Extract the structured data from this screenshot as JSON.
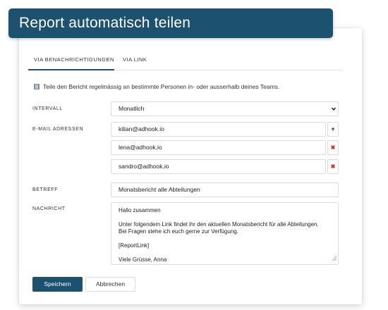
{
  "header": {
    "title": "Report automatisch teilen"
  },
  "tabs": [
    {
      "label": "VIA BENACHRICHTIGUNGEN",
      "active": true
    },
    {
      "label": "VIA LINK",
      "active": false
    }
  ],
  "info_text": "Teile den Bericht regelmässig an bestimmte Personen in- oder ausserhalb deines Teams.",
  "form": {
    "interval": {
      "label": "INTERVALL",
      "value": "Monatlich",
      "icon": "chevron-down-icon"
    },
    "emails": {
      "label": "E-MAIL ADRESSEN",
      "items": [
        "kilian@adhook.io",
        "lena@adhook.io",
        "sandro@adhook.io"
      ],
      "add_glyph": "+",
      "remove_glyph": "✖"
    },
    "subject": {
      "label": "BETREFF",
      "value": "Monatsbericht alle Abteilungen"
    },
    "message": {
      "label": "NACHRICHT",
      "lines": [
        "Hallo zusammen",
        "Unter folgendem Link findet ihr den aktuellen Monatsbericht für alle Abteilungen.",
        "Bei Fragen stehe ich euch gerne zur Verfügung.",
        "[ReportLink]",
        "Viele Grüsse, Anna"
      ]
    }
  },
  "buttons": {
    "save": "Speichern",
    "cancel": "Abbrechen"
  },
  "colors": {
    "primary": "#1c5170",
    "danger": "#d9262a"
  }
}
